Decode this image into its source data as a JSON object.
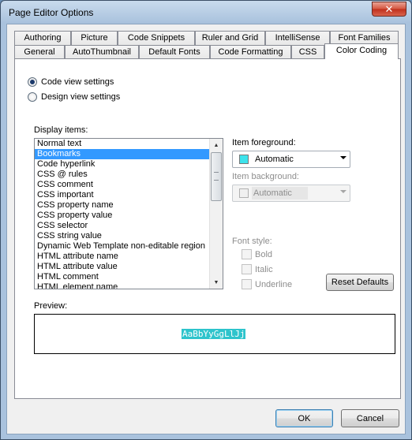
{
  "window": {
    "title": "Page Editor Options",
    "close_glyph": "✕"
  },
  "tabs": {
    "row_top": [
      "Authoring",
      "Picture",
      "Code Snippets",
      "Ruler and Grid",
      "IntelliSense",
      "Font Families"
    ],
    "row_bottom": [
      "General",
      "AutoThumbnail",
      "Default Fonts",
      "Code Formatting",
      "CSS",
      "Color Coding"
    ],
    "active": "Color Coding"
  },
  "view_mode": {
    "options": [
      "Code view settings",
      "Design view settings"
    ],
    "selected": "Code view settings"
  },
  "display_items": {
    "label": "Display items:",
    "items": [
      "Normal text",
      "Bookmarks",
      "Code hyperlink",
      "CSS @ rules",
      "CSS comment",
      "CSS important",
      "CSS property name",
      "CSS property value",
      "CSS selector",
      "CSS string value",
      "Dynamic Web Template non-editable region",
      "HTML attribute name",
      "HTML attribute value",
      "HTML comment",
      "HTML element name"
    ],
    "selected": "Bookmarks"
  },
  "item_foreground": {
    "label": "Item foreground:",
    "value": "Automatic",
    "swatch_color": "#3de3ec"
  },
  "item_background": {
    "label": "Item background:",
    "value": "Automatic",
    "swatch_color": "#f0f0f0"
  },
  "font_style": {
    "label": "Font style:",
    "options": [
      "Bold",
      "Italic",
      "Underline"
    ]
  },
  "reset_defaults_label": "Reset Defaults",
  "preview": {
    "label": "Preview:",
    "sample": "AaBbYyGgLlJj",
    "sample_bg": "#2ec4cc"
  },
  "buttons": {
    "ok": "OK",
    "cancel": "Cancel"
  },
  "colors": {
    "selection": "#3399ff",
    "title_gradient_top": "#c9dbed",
    "close_red": "#c8402a"
  }
}
